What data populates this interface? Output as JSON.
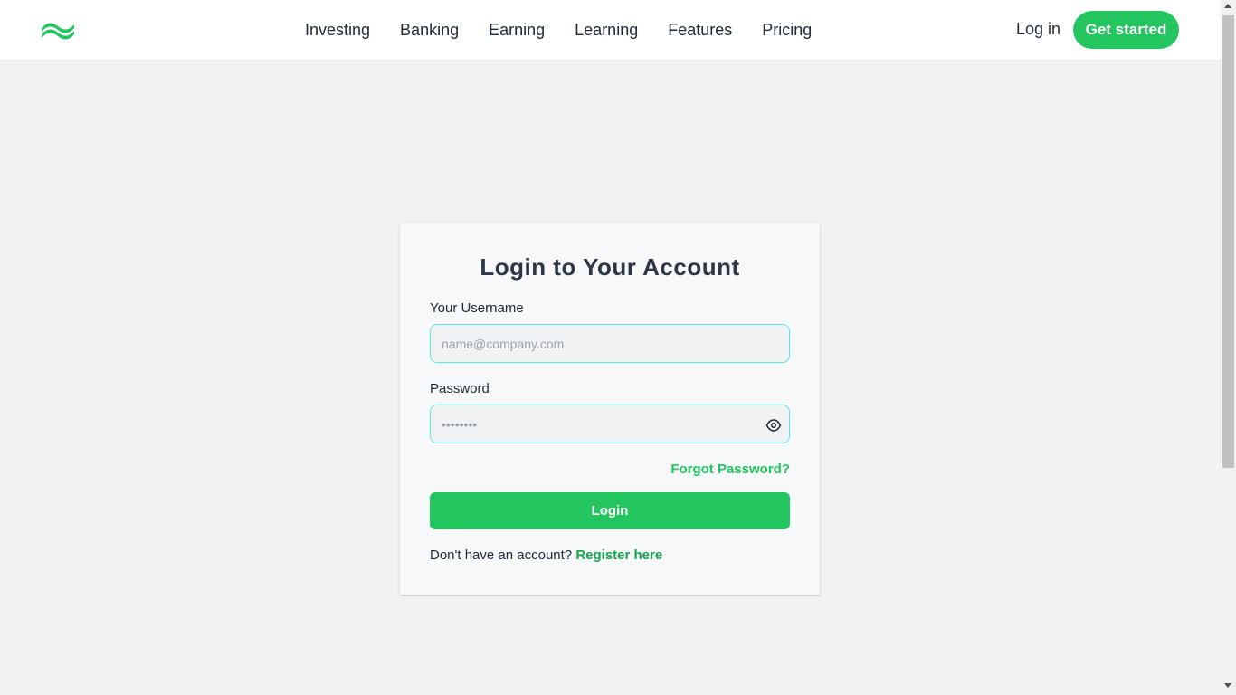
{
  "nav": {
    "logo_icon": "wave-logo-icon",
    "links": [
      "Investing",
      "Banking",
      "Earning",
      "Learning",
      "Features",
      "Pricing"
    ],
    "login_label": "Log in",
    "cta_label": "Get started"
  },
  "login_card": {
    "title": "Login to Your Account",
    "username_label": "Your Username",
    "username_placeholder": "name@company.com",
    "username_value": "",
    "password_label": "Password",
    "password_placeholder": "••••••••",
    "password_value": "",
    "password_toggle_icon": "eye-icon",
    "forgot_label": "Forgot Password?",
    "submit_label": "Login",
    "register_prompt": "Don't have an account?",
    "register_link": "Register here"
  },
  "colors": {
    "accent": "#22c55e",
    "input_border": "#5eead4",
    "page_bg": "#f1f2f4",
    "text": "#1f2937"
  }
}
